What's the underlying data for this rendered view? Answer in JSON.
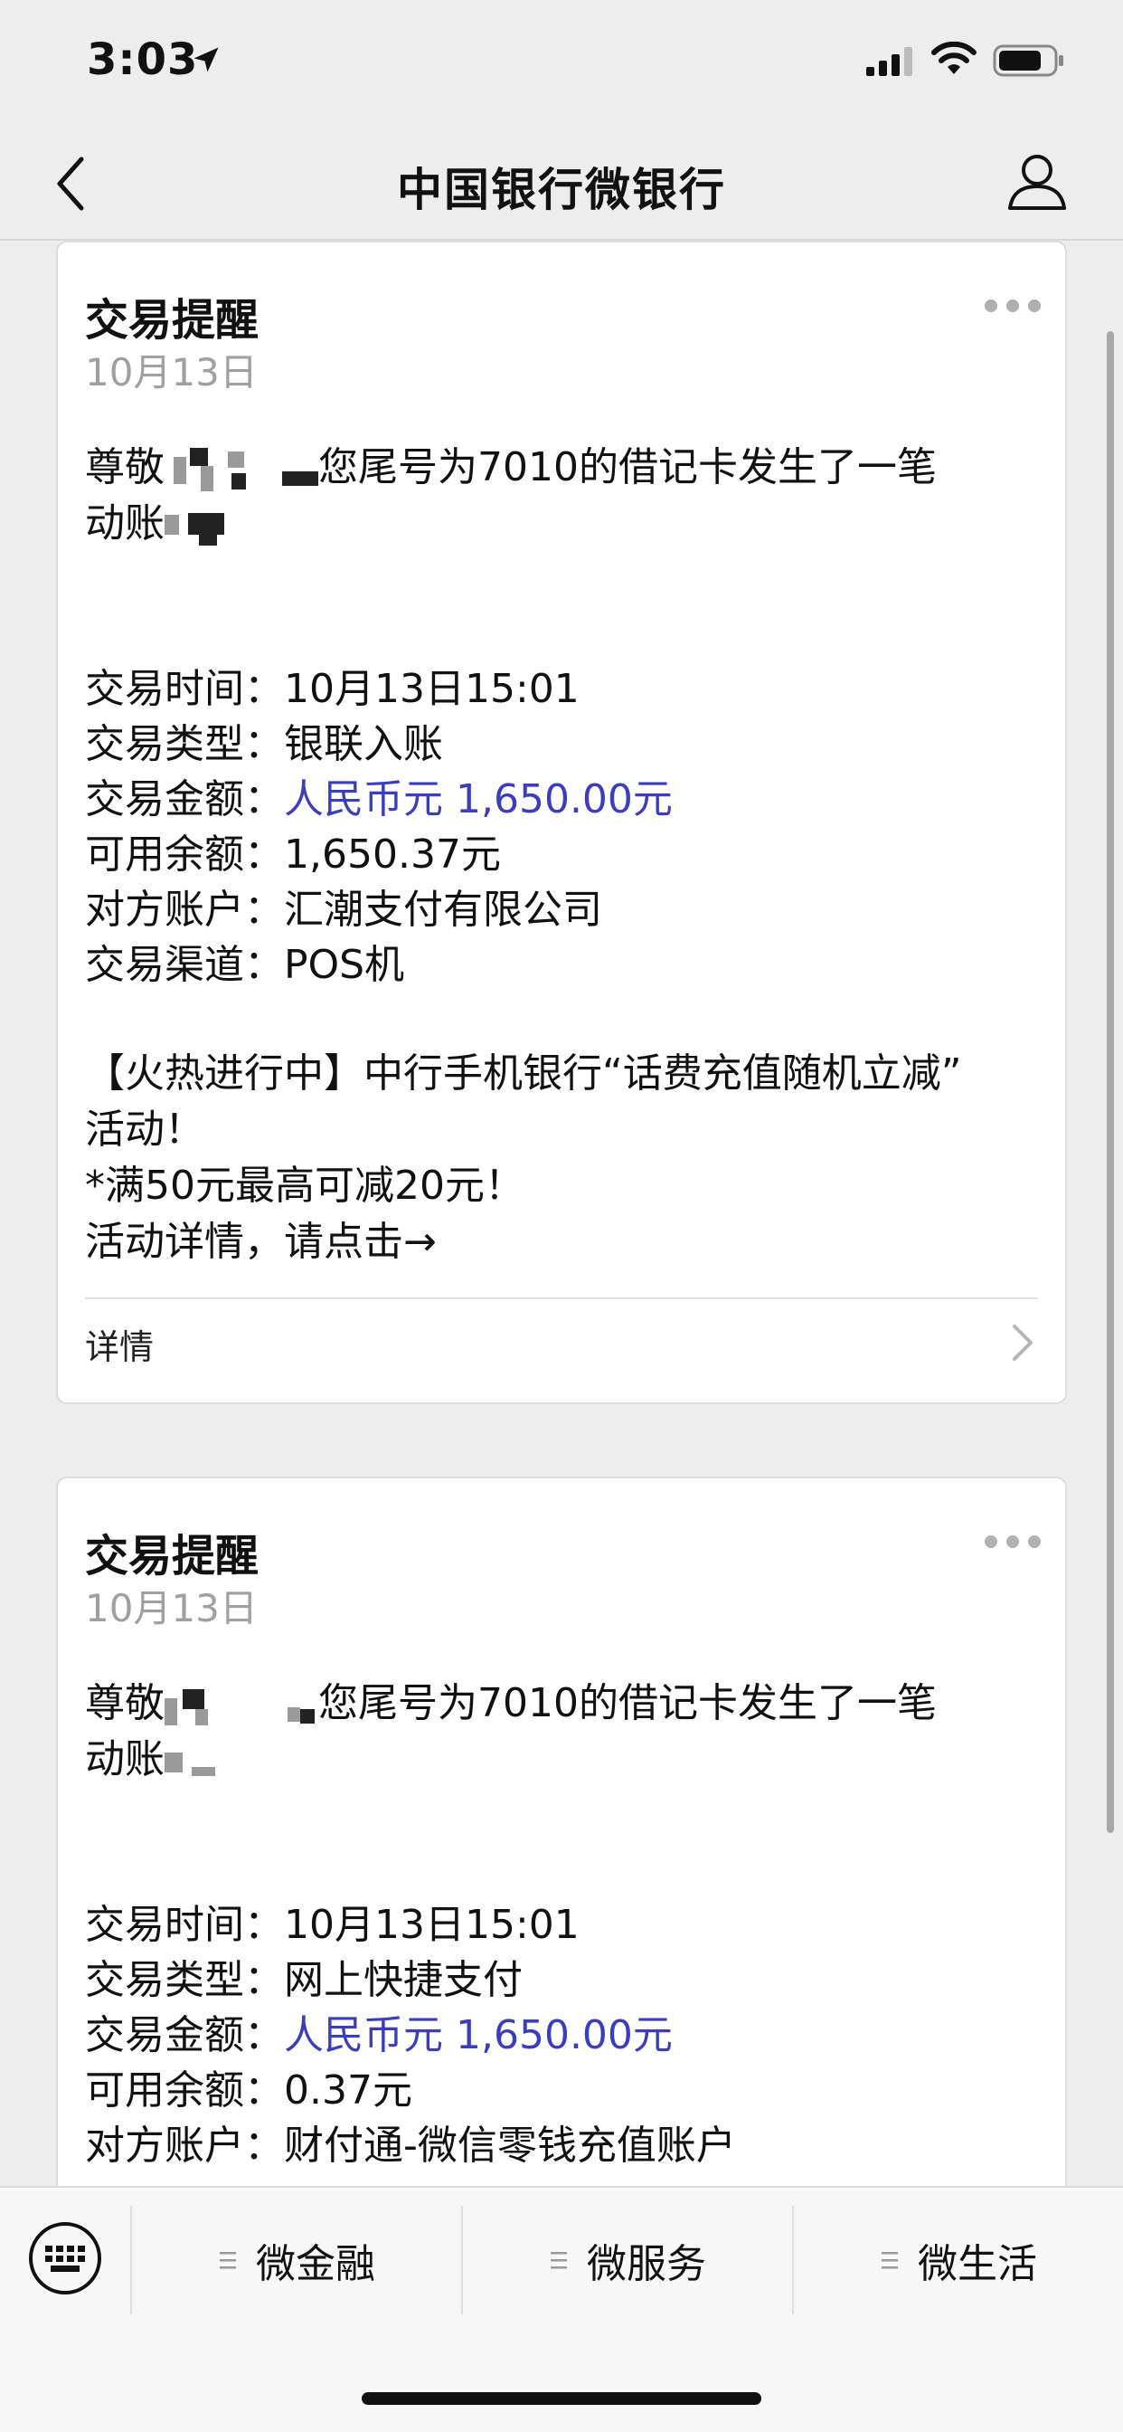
{
  "status_bar": {
    "time": "3:03"
  },
  "nav": {
    "title": "中国银行微银行"
  },
  "cards": [
    {
      "title": "交易提醒",
      "date": "10月13日",
      "greeting_a": "尊敬",
      "greeting_b": "您尾号为7010的借记卡发生了一笔",
      "greeting_c": "动账",
      "fields": [
        {
          "label": "交易时间",
          "value": "10月13日15:01"
        },
        {
          "label": "交易类型",
          "value": "银联入账"
        },
        {
          "label": "交易金额",
          "value": "人民币元 1,650.00元"
        },
        {
          "label": "可用余额",
          "value": "1,650.37元"
        },
        {
          "label": "对方账户",
          "value": "汇潮支付有限公司"
        },
        {
          "label": "交易渠道",
          "value": "POS机"
        }
      ],
      "promo": [
        "【火热进行中】中行手机银行“话费充值随机立减”",
        "活动！",
        "*满50元最高可减20元！",
        "活动详情，请点击→"
      ],
      "detail_label": "详情"
    },
    {
      "title": "交易提醒",
      "date": "10月13日",
      "greeting_a": "尊敬",
      "greeting_b": "您尾号为7010的借记卡发生了一笔",
      "greeting_c": "动账",
      "fields": [
        {
          "label": "交易时间",
          "value": "10月13日15:01"
        },
        {
          "label": "交易类型",
          "value": "网上快捷支付"
        },
        {
          "label": "交易金额",
          "value": "人民币元 1,650.00元"
        },
        {
          "label": "可用余额",
          "value": "0.37元"
        },
        {
          "label": "对方账户",
          "value": "财付通-微信零钱充值账户"
        }
      ]
    }
  ],
  "menu": {
    "items": [
      {
        "label": "微金融"
      },
      {
        "label": "微服务"
      },
      {
        "label": "微生活"
      }
    ]
  },
  "colors": {
    "amount_blue": "#3b3dbf",
    "background": "#ededed"
  },
  "icons": [
    "location-arrow-icon",
    "signal-icon",
    "wifi-icon",
    "battery-icon",
    "back-icon",
    "profile-icon",
    "more-icon",
    "chevron-right-icon",
    "keyboard-icon",
    "menu-list-icon"
  ]
}
